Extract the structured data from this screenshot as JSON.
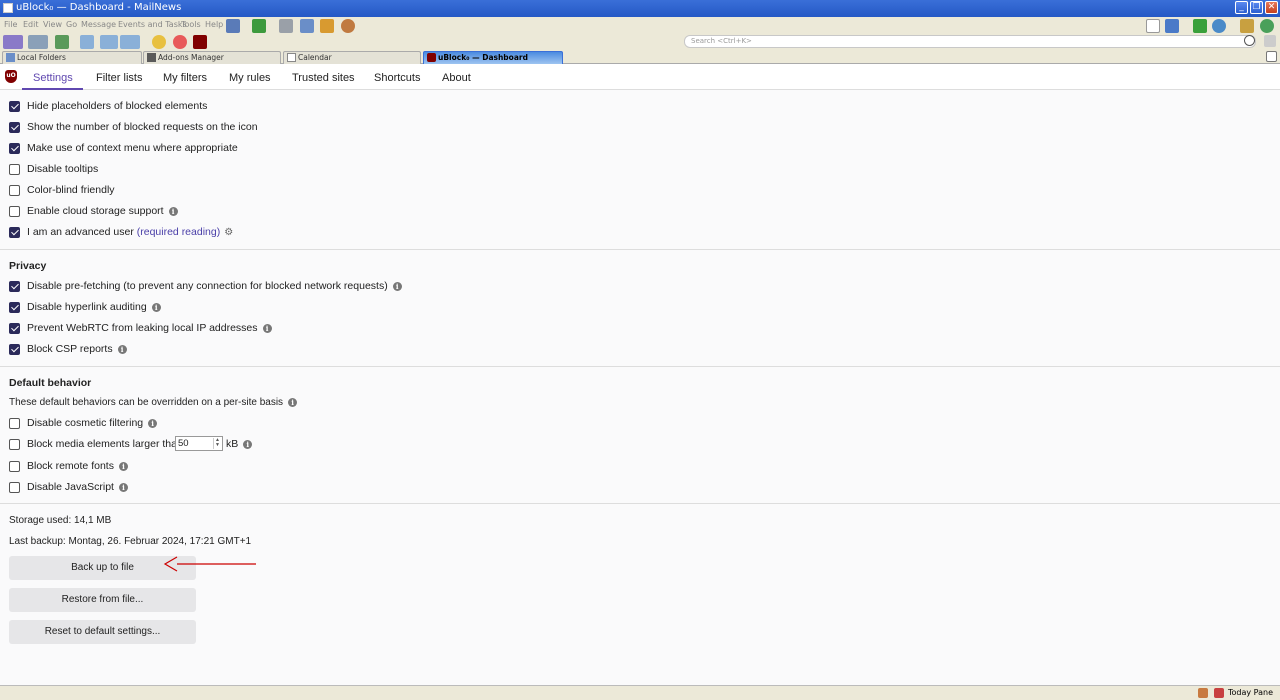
{
  "window": {
    "title": "uBlock₀ — Dashboard - MailNews"
  },
  "menu": [
    "File",
    "Edit",
    "View",
    "Go",
    "Message",
    "Events and Tasks",
    "Tools",
    "Help"
  ],
  "search": {
    "placeholder": "Search <Ctrl+K>"
  },
  "window_tabs": [
    {
      "label": "Local Folders"
    },
    {
      "label": "Add-ons Manager"
    },
    {
      "label": "Calendar"
    },
    {
      "label": "uBlock₀ — Dashboard"
    }
  ],
  "dashboard_tabs": [
    "Settings",
    "Filter lists",
    "My filters",
    "My rules",
    "Trusted sites",
    "Shortcuts",
    "About"
  ],
  "appearance": {
    "items": [
      {
        "label": "Hide placeholders of blocked elements",
        "checked": true
      },
      {
        "label": "Show the number of blocked requests on the icon",
        "checked": true
      },
      {
        "label": "Make use of context menu where appropriate",
        "checked": true
      },
      {
        "label": "Disable tooltips",
        "checked": false
      },
      {
        "label": "Color-blind friendly",
        "checked": false
      },
      {
        "label": "Enable cloud storage support",
        "checked": false
      }
    ],
    "advanced": {
      "label": "I am an advanced user",
      "link": "(required reading)",
      "checked": true
    }
  },
  "privacy": {
    "title": "Privacy",
    "items": [
      {
        "label": "Disable pre-fetching (to prevent any connection for blocked network requests)",
        "checked": true
      },
      {
        "label": "Disable hyperlink auditing",
        "checked": true
      },
      {
        "label": "Prevent WebRTC from leaking local IP addresses",
        "checked": true
      },
      {
        "label": "Block CSP reports",
        "checked": true
      }
    ]
  },
  "default_behavior": {
    "title": "Default behavior",
    "note": "These default behaviors can be overridden on a per-site basis",
    "items": [
      {
        "label": "Disable cosmetic filtering",
        "checked": false
      },
      {
        "label": "Block media elements larger than",
        "checked": false,
        "value": "50",
        "unit": "kB"
      },
      {
        "label": "Block remote fonts",
        "checked": false
      },
      {
        "label": "Disable JavaScript",
        "checked": false
      }
    ]
  },
  "storage": {
    "used": "Storage used: 14,1 MB",
    "last_backup": "Last backup: Montag, 26. Februar 2024, 17:21 GMT+1",
    "buttons": [
      "Back up to file",
      "Restore from file...",
      "Reset to default settings..."
    ]
  },
  "statusbar": {
    "today_pane": "Today Pane"
  },
  "colors": {
    "accent": "#6048b0",
    "checkbox": "#2b2a5a",
    "annotation_arrow": "#cc0000"
  }
}
